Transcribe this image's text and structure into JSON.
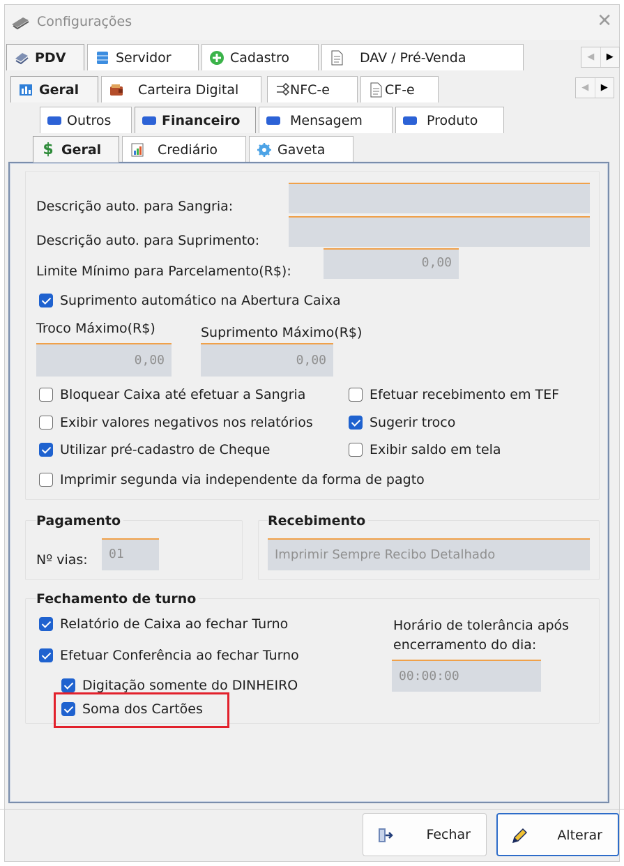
{
  "window": {
    "title": "Configurações"
  },
  "tabs_row1": [
    {
      "label": "PDV",
      "icon": "pdv-icon",
      "active": true
    },
    {
      "label": "Servidor",
      "icon": "server-icon"
    },
    {
      "label": "Cadastro",
      "icon": "add-icon"
    },
    {
      "label": "DAV / Pré-Venda",
      "icon": "document-icon"
    }
  ],
  "tabs_row2": [
    {
      "label": "Geral",
      "icon": "general-icon",
      "active": true
    },
    {
      "label": "Carteira Digital",
      "icon": "wallet-icon"
    },
    {
      "label": "NFC-e",
      "icon": "nfce-icon"
    },
    {
      "label": "CF-e",
      "icon": "document-icon"
    }
  ],
  "tabs_row3": [
    {
      "label": "Outros",
      "icon": "tab-blue-icon"
    },
    {
      "label": "Financeiro",
      "icon": "tab-blue-icon",
      "active": true
    },
    {
      "label": "Mensagem",
      "icon": "tab-blue-icon"
    },
    {
      "label": "Produto",
      "icon": "tab-blue-icon"
    }
  ],
  "tabs_row4": [
    {
      "label": "Geral",
      "icon": "dollar-icon",
      "active": true
    },
    {
      "label": "Crediário",
      "icon": "chart-icon"
    },
    {
      "label": "Gaveta",
      "icon": "gear-icon"
    }
  ],
  "geral": {
    "sangria_label": "Descrição auto. para Sangria:",
    "sangria_value": "",
    "suprimento_label": "Descrição auto. para Suprimento:",
    "suprimento_value": "",
    "limite_label": "Limite Mínimo para Parcelamento(R$):",
    "limite_value": "0,00",
    "suprimento_auto": {
      "label": "Suprimento automático na Abertura Caixa",
      "checked": true
    },
    "troco_max_label": "Troco Máximo(R$)",
    "troco_max_value": "0,00",
    "suprimento_max_label": "Suprimento Máximo(R$)",
    "suprimento_max_value": "0,00",
    "checkboxes": {
      "bloquear_caixa": {
        "label": "Bloquear Caixa até efetuar a Sangria",
        "checked": false
      },
      "efetuar_tef": {
        "label": "Efetuar recebimento em TEF",
        "checked": false
      },
      "exibir_negativos": {
        "label": "Exibir valores negativos nos relatórios",
        "checked": false
      },
      "sugerir_troco": {
        "label": "Sugerir troco",
        "checked": true
      },
      "pre_cadastro_cheque": {
        "label": "Utilizar pré-cadastro de Cheque",
        "checked": true
      },
      "exibir_saldo": {
        "label": "Exibir saldo em tela",
        "checked": false
      },
      "segunda_via": {
        "label": "Imprimir segunda via independente da forma de pagto",
        "checked": false
      }
    }
  },
  "pagamento": {
    "title": "Pagamento",
    "vias_label": "Nº vias:",
    "vias_value": "01"
  },
  "recebimento": {
    "title": "Recebimento",
    "value": "Imprimir Sempre Recibo Detalhado"
  },
  "fechamento": {
    "title": "Fechamento de turno",
    "relatorio_caixa": {
      "label": "Relatório de Caixa ao fechar Turno",
      "checked": true
    },
    "conferencia": {
      "label": "Efetuar Conferência ao fechar Turno",
      "checked": true
    },
    "digitacao_dinheiro": {
      "label": "Digitação somente do DINHEIRO",
      "checked": true
    },
    "soma_cartoes": {
      "label": "Soma dos Cartões",
      "checked": true
    },
    "tolerancia_label_1": "Horário de tolerância após",
    "tolerancia_label_2": "encerramento do dia:",
    "tolerancia_value": "00:00:00"
  },
  "footer": {
    "fechar_label": "Fechar",
    "alterar_label": "Alterar"
  },
  "colors": {
    "accent_orange": "#f0a14a",
    "check_blue": "#1f62cf",
    "highlight_red": "#e2212c",
    "content_border": "#7a8dab"
  }
}
